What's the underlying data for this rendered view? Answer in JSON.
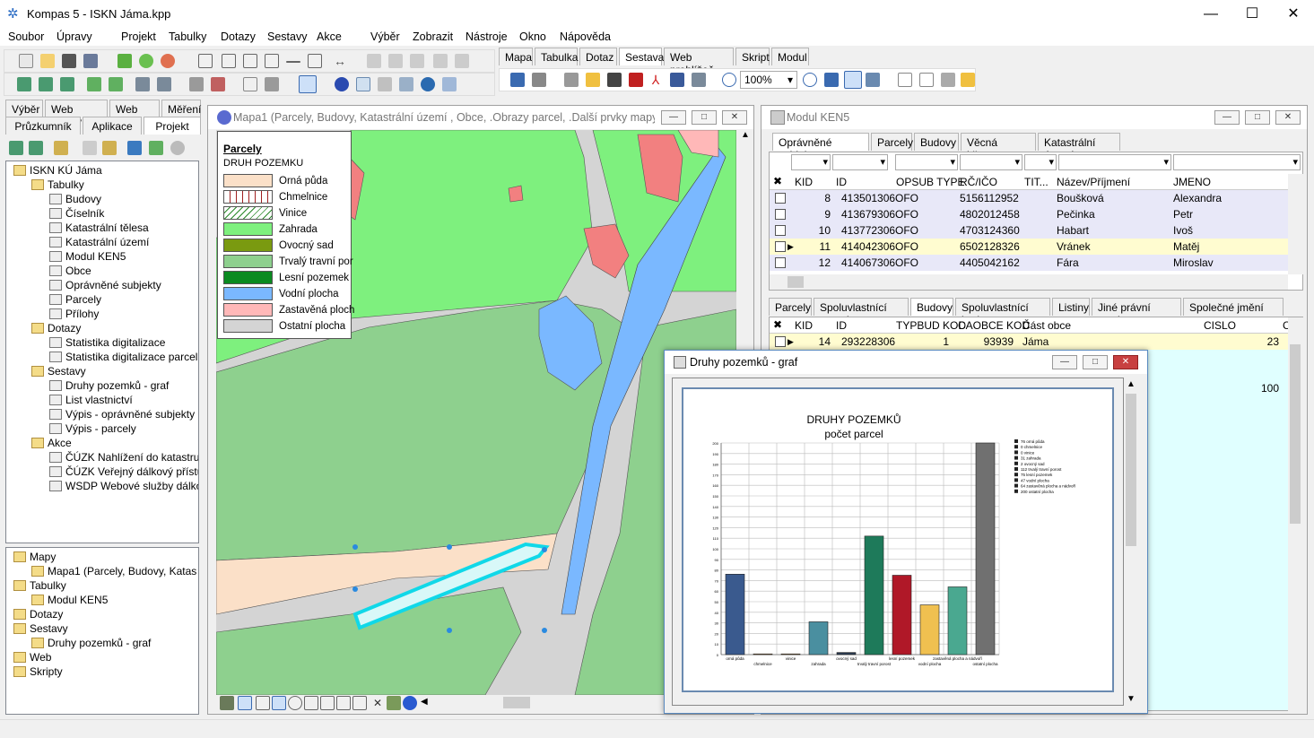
{
  "window": {
    "title": "Kompas 5 - ISKN Jáma.kpp"
  },
  "menu": [
    "Soubor",
    "Úpravy",
    "Projekt",
    "Tabulky",
    "Dotazy",
    "Sestavy",
    "Akce",
    "Výběr",
    "Zobrazit",
    "Nástroje",
    "Okno",
    "Nápověda"
  ],
  "toolbar_tabs": [
    "Mapa",
    "Tabulka",
    "Dotaz",
    "Sestava",
    "Web prohlížeč",
    "Skript",
    "Modul"
  ],
  "zoom": "100%",
  "left_tabs_top": [
    "Výběr",
    "Web služby",
    "Web info",
    "Měření"
  ],
  "left_tabs_bottom": [
    "Průzkumník",
    "Aplikace",
    "Projekt"
  ],
  "tree1": [
    {
      "label": "ISKN KÚ Jáma",
      "level": 0
    },
    {
      "label": "Tabulky",
      "level": 1
    },
    {
      "label": "Budovy",
      "level": 2
    },
    {
      "label": "Číselník",
      "level": 2
    },
    {
      "label": "Katastrální tělesa",
      "level": 2
    },
    {
      "label": "Katastrální území",
      "level": 2
    },
    {
      "label": "Modul KEN5",
      "level": 2
    },
    {
      "label": "Obce",
      "level": 2
    },
    {
      "label": "Oprávněné subjekty",
      "level": 2
    },
    {
      "label": "Parcely",
      "level": 2
    },
    {
      "label": "Přílohy",
      "level": 2
    },
    {
      "label": "Dotazy",
      "level": 1
    },
    {
      "label": "Statistika digitalizace",
      "level": 2
    },
    {
      "label": "Statistika digitalizace parcel",
      "level": 2
    },
    {
      "label": "Sestavy",
      "level": 1
    },
    {
      "label": "Druhy pozemků - graf",
      "level": 2
    },
    {
      "label": "List vlastnictví",
      "level": 2
    },
    {
      "label": "Výpis - oprávněné subjekty",
      "level": 2
    },
    {
      "label": "Výpis - parcely",
      "level": 2
    },
    {
      "label": "Akce",
      "level": 1
    },
    {
      "label": "ČÚZK Nahlížení do katastru",
      "level": 2
    },
    {
      "label": "ČÚZK Veřejný dálkový přístu",
      "level": 2
    },
    {
      "label": "WSDP Webové služby dálko",
      "level": 2
    }
  ],
  "tree2": [
    {
      "label": "Mapy",
      "level": 0
    },
    {
      "label": "Mapa1 (Parcely, Budovy, Katas",
      "level": 1
    },
    {
      "label": "Tabulky",
      "level": 0
    },
    {
      "label": "Modul KEN5",
      "level": 1
    },
    {
      "label": "Dotazy",
      "level": 0
    },
    {
      "label": "Sestavy",
      "level": 0
    },
    {
      "label": "Druhy pozemků - graf",
      "level": 1
    },
    {
      "label": "Web",
      "level": 0
    },
    {
      "label": "Skripty",
      "level": 0
    }
  ],
  "map_window": {
    "title": "Mapa1 (Parcely, Budovy, Katastrální území , Obce, .Obrazy parcel, .Další prvky mapy, .O...",
    "legend_title": "Parcely",
    "legend_subtitle": "DRUH POZEMKU",
    "legend": [
      {
        "label": "Orná půda",
        "color": "#fbe0c8"
      },
      {
        "label": "Chmelnice",
        "color": "#ffffff"
      },
      {
        "label": "Vinice",
        "color": "#ffffff"
      },
      {
        "label": "Zahrada",
        "color": "#7ef07e"
      },
      {
        "label": "Ovocný sad",
        "color": "#7a9a10"
      },
      {
        "label": "Trvalý travní por",
        "color": "#8ed08e"
      },
      {
        "label": "Lesní pozemek",
        "color": "#0a8a20"
      },
      {
        "label": "Vodní plocha",
        "color": "#7ab8ff"
      },
      {
        "label": "Zastavěná ploch",
        "color": "#ffb8b8"
      },
      {
        "label": "Ostatní plocha",
        "color": "#d4d4d4"
      }
    ]
  },
  "ken5_window": {
    "title": "Modul KEN5",
    "tabs": [
      "Oprávněné subjekty",
      "Parcely",
      "Budovy",
      "Věcná břemena",
      "Katastrální území"
    ],
    "columns": [
      "KID",
      "ID",
      "OPSUB TYPE",
      "RČ/IČO",
      "TIT...",
      "Název/Příjmení",
      "JMENO"
    ],
    "rows": [
      [
        "8",
        "413501306",
        "OFO",
        "5156112952",
        "",
        "Boušková",
        "Alexandra"
      ],
      [
        "9",
        "413679306",
        "OFO",
        "4802012458",
        "",
        "Pečinka",
        "Petr"
      ],
      [
        "10",
        "413772306",
        "OFO",
        "4703124360",
        "",
        "Habart",
        "Ivoš"
      ],
      [
        "11",
        "414042306",
        "OFO",
        "6502128326",
        "",
        "Vránek",
        "Matěj"
      ],
      [
        "12",
        "414067306",
        "OFO",
        "4405042162",
        "",
        "Fára",
        "Miroslav"
      ]
    ],
    "tabs2": [
      "Parcely",
      "Spoluvlastnící parcel",
      "Budovy",
      "Spoluvlastnící budov",
      "Listiny",
      "Jiné právní vztahy",
      "Společné jmění manže"
    ],
    "columns2": [
      "KID",
      "ID",
      "TYPBUD KOD",
      "CAOBCE KOD",
      "Část obce",
      "CISLO DOMOVNI",
      "C"
    ],
    "rows2": [
      [
        "14",
        "293228306",
        "1",
        "93939",
        "Jáma",
        "23"
      ]
    ],
    "extra_value": "100"
  },
  "chart_window": {
    "title": "Druhy pozemků - graf"
  },
  "chart_data": {
    "type": "bar",
    "title": "DRUHY POZEMKŮ",
    "subtitle": "počet parcel",
    "categories": [
      "orná půda",
      "chmelnice",
      "vinice",
      "zahrada",
      "ovocný sad",
      "trvalý travní porost",
      "lesní pozemek",
      "vodní plocha",
      "zastavěná plocha a nádvoří",
      "ostatní plocha"
    ],
    "values": [
      76,
      0,
      0,
      31,
      2,
      112,
      75,
      47,
      64,
      200
    ],
    "colors": [
      "#3a5a8e",
      "#d9a050",
      "#d9a050",
      "#4a8fa0",
      "#2a3a50",
      "#1e7a5a",
      "#b01828",
      "#f0c050",
      "#4aa890",
      "#707070"
    ],
    "ylim": [
      0,
      200
    ],
    "yticks": [
      0,
      10,
      20,
      30,
      40,
      50,
      60,
      70,
      80,
      90,
      100,
      110,
      120,
      130,
      140,
      150,
      160,
      170,
      180,
      190,
      200
    ],
    "legend": [
      "76  orná půda",
      "0  chmelnice",
      "0  vinice",
      "31  zahrada",
      "2  ovocný sad",
      "112  trvalý travní porost",
      "75  lesní pozemek",
      "47  vodní plocha",
      "64  zastavěná plocha a nádvoří",
      "200  ostatní plocha"
    ]
  }
}
